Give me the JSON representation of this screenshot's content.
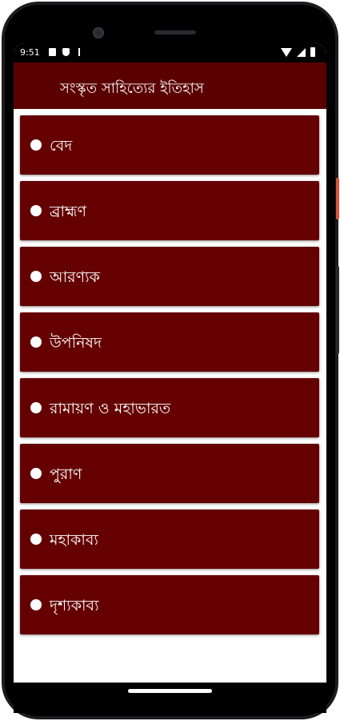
{
  "status": {
    "time": "9:51",
    "left_icons": [
      "notification-icon",
      "shield-icon",
      "download-icon"
    ],
    "right_icons": [
      "wifi-icon",
      "signal-icon",
      "battery-icon"
    ]
  },
  "appbar": {
    "title": "সংস্কৃত সাহিত্যের ইতিহাস"
  },
  "list": {
    "items": [
      {
        "label": "বেদ"
      },
      {
        "label": "ব্রাহ্মণ"
      },
      {
        "label": "আরণ্যক"
      },
      {
        "label": "উপনিষদ"
      },
      {
        "label": "রামায়ণ ও মহাভারত"
      },
      {
        "label": "পুরাণ"
      },
      {
        "label": "মহাকাব্য"
      },
      {
        "label": "দৃশ্যকাব্য"
      }
    ]
  },
  "colors": {
    "appbar": "#5b0000",
    "item_background": "#650000",
    "text": "#ffffff"
  }
}
